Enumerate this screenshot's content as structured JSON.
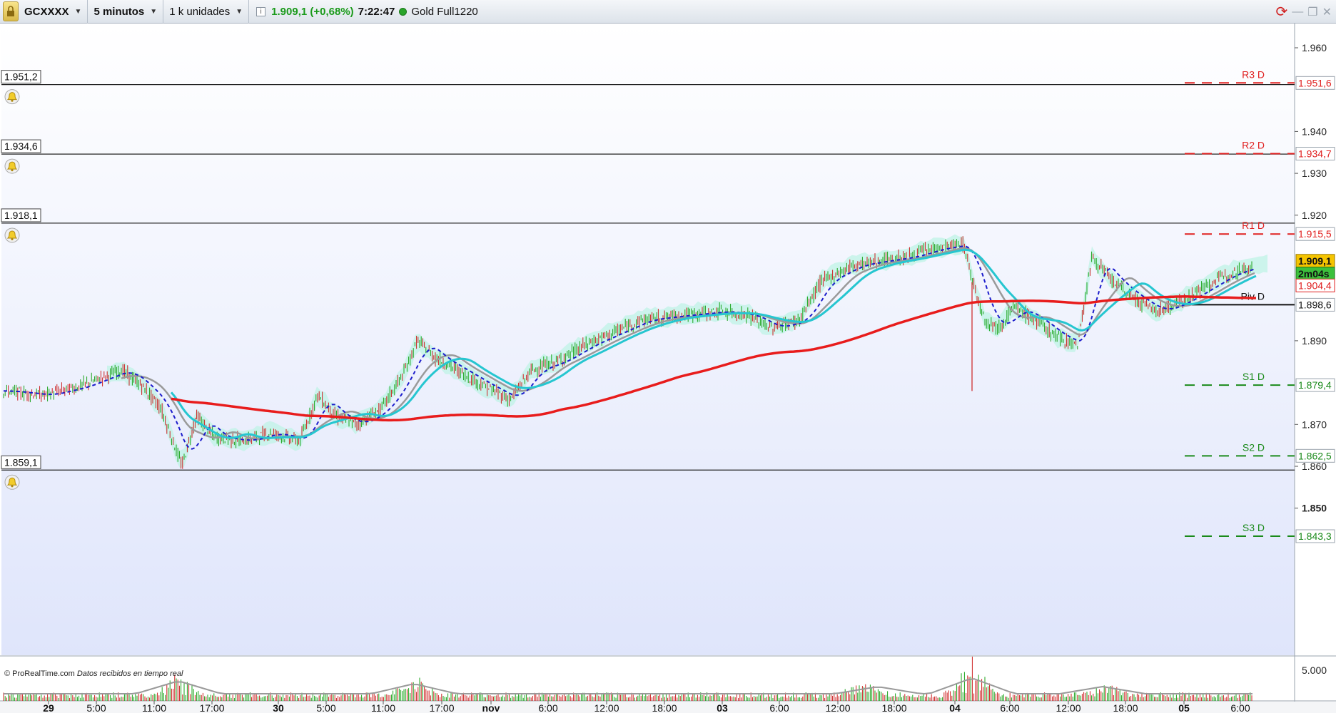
{
  "toolbar": {
    "instrument": "GCXXXX",
    "timeframe": "5 minutos",
    "units": "1 k unidades",
    "last_price_change": "1.909,1 (+0,68%)",
    "time": "7:22:47",
    "feed_name": "Gold Full1220"
  },
  "watermark": {
    "brand": "© ProRealTime.com",
    "note": "Datos recibidos en tiempo real"
  },
  "alert_lines": [
    {
      "label": "1.951,2",
      "price": 1951.2
    },
    {
      "label": "1.934,6",
      "price": 1934.6
    },
    {
      "label": "1.918,1",
      "price": 1918.1
    },
    {
      "label": "1.859,1",
      "price": 1859.1
    }
  ],
  "pivots": [
    {
      "name": "R3 D",
      "label": "1.951,6",
      "price": 1951.6,
      "color": "#e02020"
    },
    {
      "name": "R2 D",
      "label": "1.934,7",
      "price": 1934.7,
      "color": "#e02020"
    },
    {
      "name": "R1 D",
      "label": "1.915,5",
      "price": 1915.5,
      "color": "#e02020"
    },
    {
      "name": "Piv D",
      "label": "1.898,6",
      "price": 1898.6,
      "color": "#111111"
    },
    {
      "name": "S1 D",
      "label": "1.879,4",
      "price": 1879.4,
      "color": "#1a8a1a"
    },
    {
      "name": "S2 D",
      "label": "1.862,5",
      "price": 1862.5,
      "color": "#1a8a1a"
    },
    {
      "name": "S3 D",
      "label": "1.843,3",
      "price": 1843.3,
      "color": "#1a8a1a"
    }
  ],
  "right_axis": {
    "ticks": [
      {
        "label": "1.960",
        "value": 1960
      },
      {
        "label": "1.940",
        "value": 1940
      },
      {
        "label": "1.930",
        "value": 1930
      },
      {
        "label": "1.920",
        "value": 1920
      },
      {
        "label": "1.890",
        "value": 1890
      },
      {
        "label": "1.870",
        "value": 1870
      },
      {
        "label": "1.860",
        "value": 1860
      },
      {
        "label": "1.850",
        "value": 1850
      }
    ],
    "last_price_tag": {
      "label": "1.909,1",
      "price": 1909.1
    },
    "countdown": "2m04s",
    "ma_tag": {
      "label": "1.904,4",
      "price": 1904.4
    }
  },
  "volume_axis": {
    "label": "5.000"
  },
  "time_axis": [
    {
      "label": "29",
      "bold": true
    },
    {
      "label": "5:00",
      "bold": false
    },
    {
      "label": "11:00",
      "bold": false
    },
    {
      "label": "17:00",
      "bold": false
    },
    {
      "label": "30",
      "bold": true
    },
    {
      "label": "5:00",
      "bold": false
    },
    {
      "label": "11:00",
      "bold": false
    },
    {
      "label": "17:00",
      "bold": false
    },
    {
      "label": "nov",
      "bold": true
    },
    {
      "label": "6:00",
      "bold": false
    },
    {
      "label": "12:00",
      "bold": false
    },
    {
      "label": "18:00",
      "bold": false
    },
    {
      "label": "03",
      "bold": true
    },
    {
      "label": "6:00",
      "bold": false
    },
    {
      "label": "12:00",
      "bold": false
    },
    {
      "label": "18:00",
      "bold": false
    },
    {
      "label": "04",
      "bold": true
    },
    {
      "label": "6:00",
      "bold": false
    },
    {
      "label": "12:00",
      "bold": false
    },
    {
      "label": "18:00",
      "bold": false
    },
    {
      "label": "05",
      "bold": true
    },
    {
      "label": "6:00",
      "bold": false
    }
  ],
  "colors": {
    "ma_slow": "#e81c1c",
    "ma_fast": "#26c6d0",
    "ma_grey": "#9a9a9a",
    "dotted": "#1c1ccc",
    "cloud": "#bff3e6",
    "up": "#1aa31a",
    "down": "#cc2020"
  }
}
